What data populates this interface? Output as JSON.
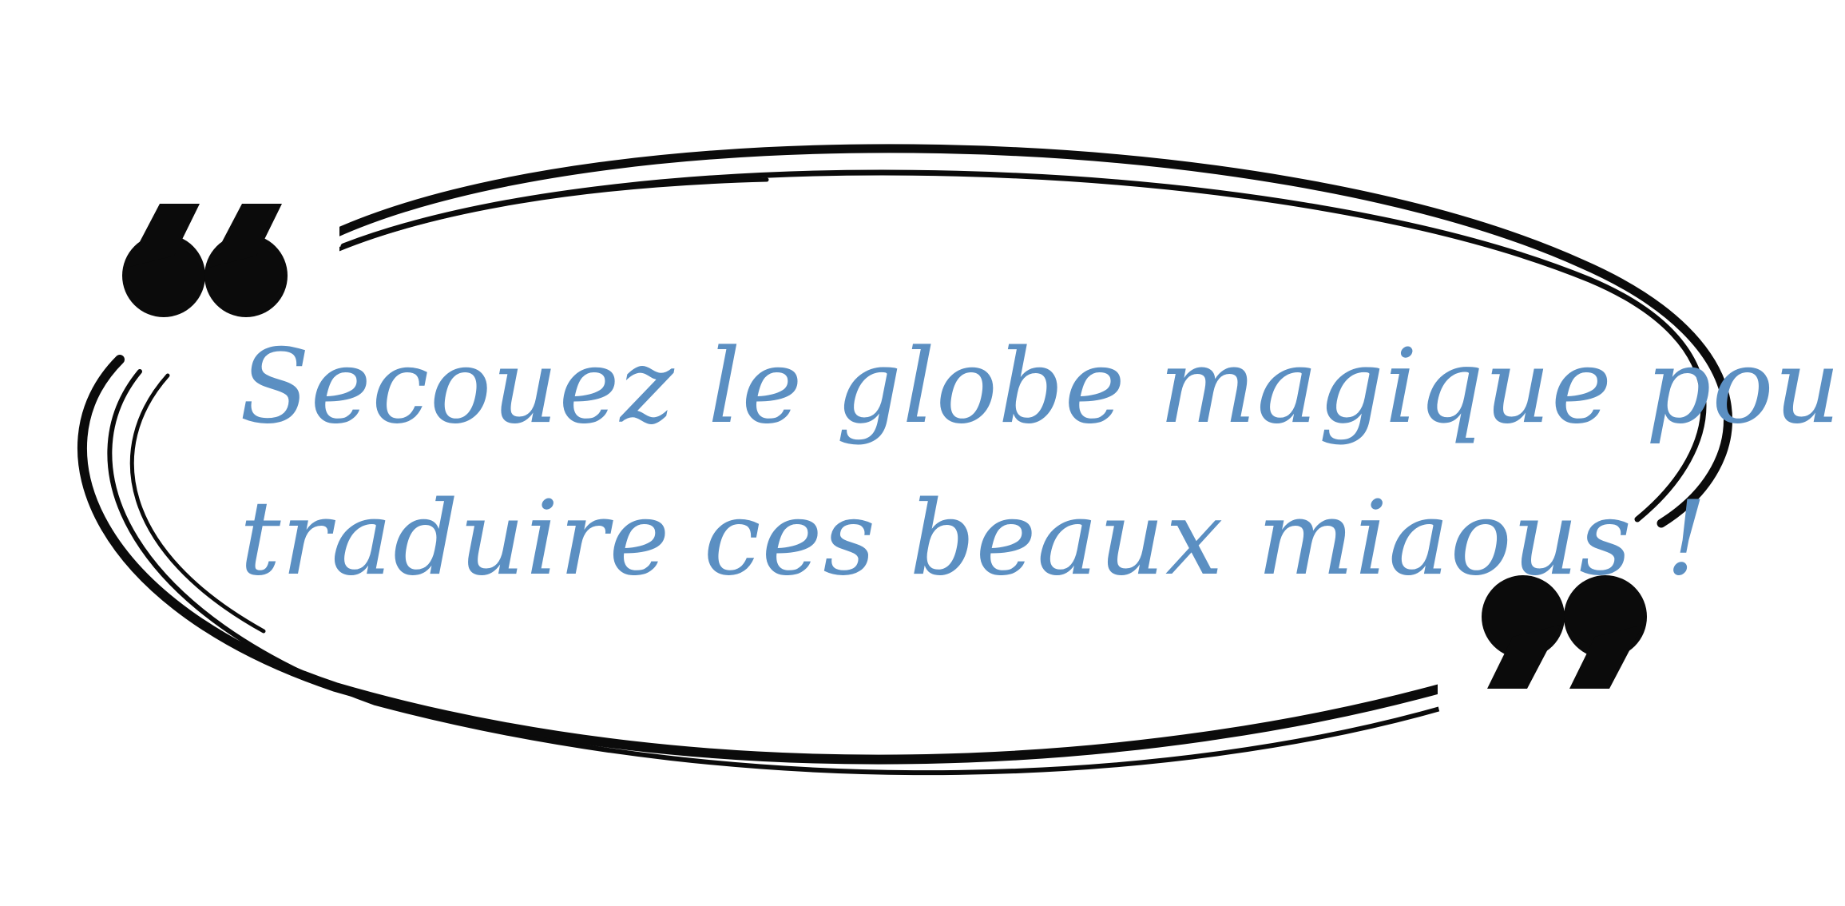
{
  "quote": {
    "line1": "Secouez le globe magique pour",
    "line2": "traduire ces beaux miaous !"
  },
  "icons": {
    "open_quote": "open-quote-icon",
    "close_quote": "close-quote-icon"
  },
  "colors": {
    "text": "#5b8fc2",
    "stroke": "#0b0b0b",
    "badge": "#ffffff"
  }
}
